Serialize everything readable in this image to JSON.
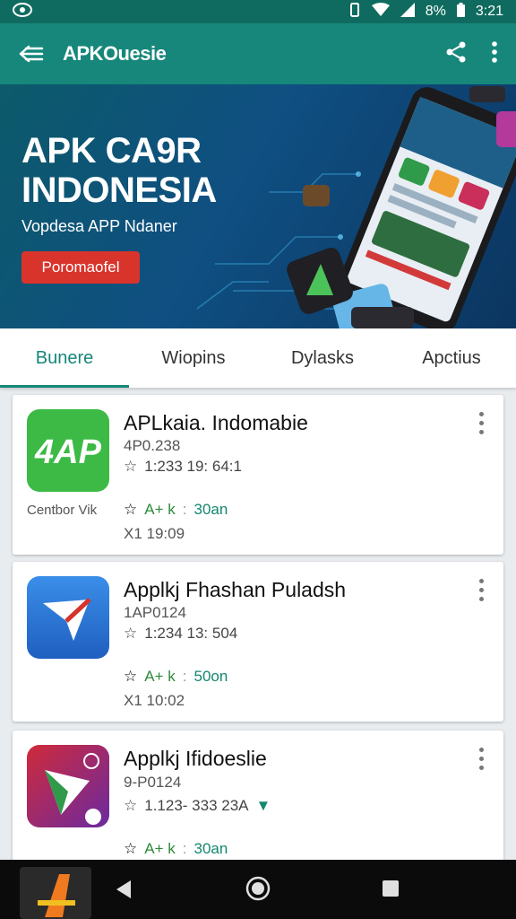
{
  "status_bar": {
    "time": "3:21",
    "battery": "8%"
  },
  "app_bar": {
    "title": "APKOuesie"
  },
  "hero": {
    "title_line1": "APK CA9R",
    "title_line2": "INDONESIA",
    "subtitle": "Vopdesa APP Ndaner",
    "cta_label": "Poromaofel"
  },
  "tabs": [
    {
      "label": "Bunere",
      "active": true
    },
    {
      "label": "Wiopins",
      "active": false
    },
    {
      "label": "Dylasks",
      "active": false
    },
    {
      "label": "Apctius",
      "active": false
    }
  ],
  "apps": [
    {
      "name": "APLkaia. Indomabie",
      "version": "4P0.238",
      "stats": "1:233 19: 64:1",
      "caption": "Centbor Vik",
      "rating_text": "A+ k",
      "downloads": "30an",
      "size": "X1 19:09"
    },
    {
      "name": "Applkj Fhashan Puladsh",
      "version": "1AP0124",
      "stats": "1:234 13: 504",
      "rating_text": "A+ k",
      "downloads": "50on",
      "size": "X1 10:02"
    },
    {
      "name": "Applkj Ifidoeslie",
      "version": "9-P0124",
      "stats": "1.123- 333 23A",
      "rating_text": "A+ k",
      "downloads": "30an"
    }
  ],
  "colors": {
    "primary": "#16877a",
    "status": "#0f6b5f",
    "accent": "#d9342b"
  },
  "icons": [
    "back-arrow-icon",
    "share-icon",
    "more-vert-icon",
    "star-icon",
    "home-icon",
    "recents-icon"
  ]
}
